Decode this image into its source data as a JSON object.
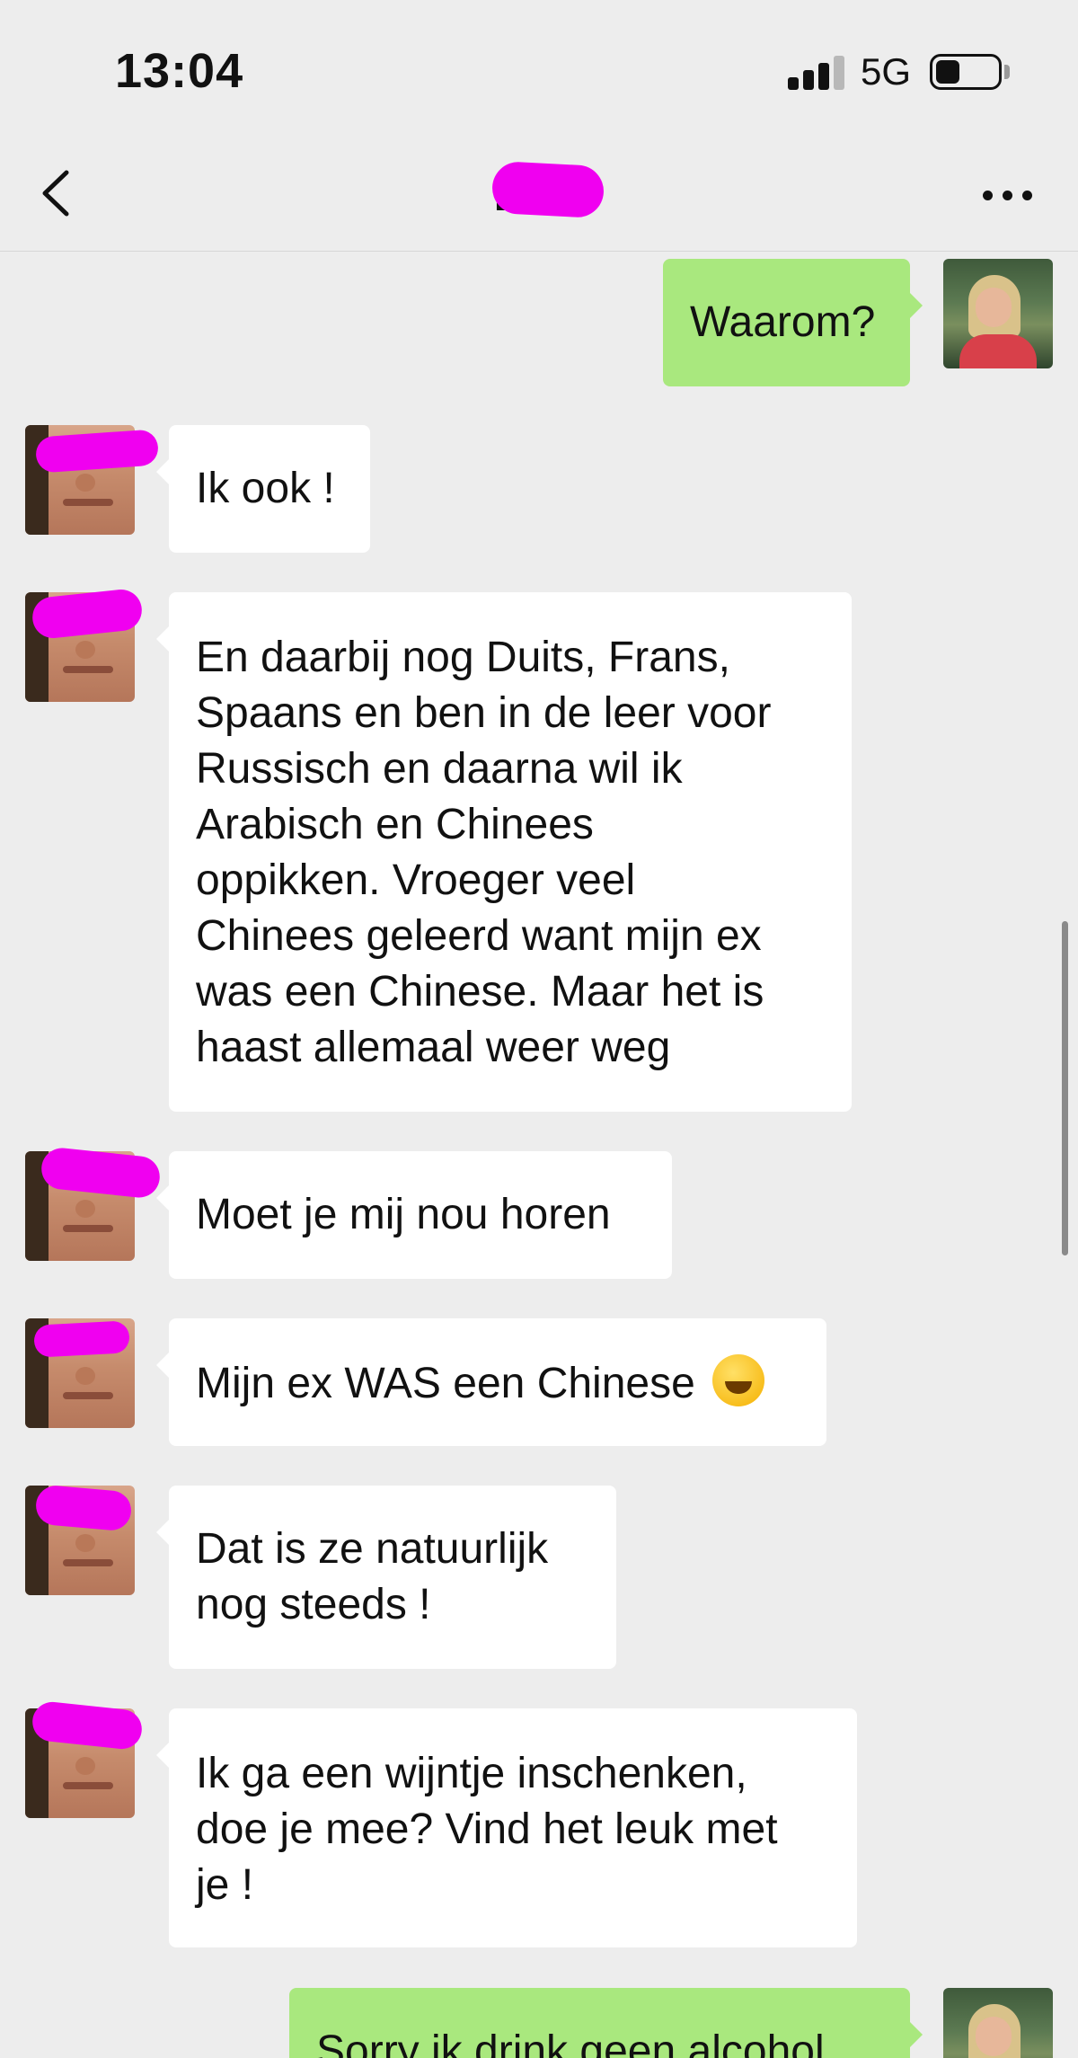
{
  "status_bar": {
    "time": "13:04",
    "network": "5G",
    "battery_level": 0.4
  },
  "nav": {
    "title": "D",
    "back_icon": "chevron-left-icon",
    "more_icon": "ellipsis-icon"
  },
  "messages": [
    {
      "from": "me",
      "text": "Waarom?"
    },
    {
      "from": "contact",
      "text": "Ik ook !"
    },
    {
      "from": "contact",
      "lines": [
        "En daarbij nog Duits, Frans,",
        "Spaans en ben in de leer voor",
        "Russisch en daarna wil ik",
        "Arabisch en Chinees",
        "oppikken. Vroeger veel",
        "Chinees geleerd want mijn ex",
        "was een Chinese. Maar het is",
        "haast allemaal weer weg"
      ]
    },
    {
      "from": "contact",
      "text": "Moet je mij nou horen"
    },
    {
      "from": "contact",
      "text": "Mijn ex WAS een Chinese",
      "emoji": "rolling-on-floor-laughing-emoji"
    },
    {
      "from": "contact",
      "lines": [
        "Dat is ze natuurlijk",
        "nog steeds !"
      ]
    },
    {
      "from": "contact",
      "lines": [
        "Ik ga een wijntje inschenken,",
        "doe je mee? Vind het leuk met",
        "je !"
      ]
    },
    {
      "from": "me",
      "text": "Sorry ik drink geen alcohol"
    }
  ],
  "colors": {
    "background": "#ededed",
    "incoming_bubble": "#ffffff",
    "outgoing_bubble": "#a9e87e",
    "redaction": "#f000f0"
  }
}
